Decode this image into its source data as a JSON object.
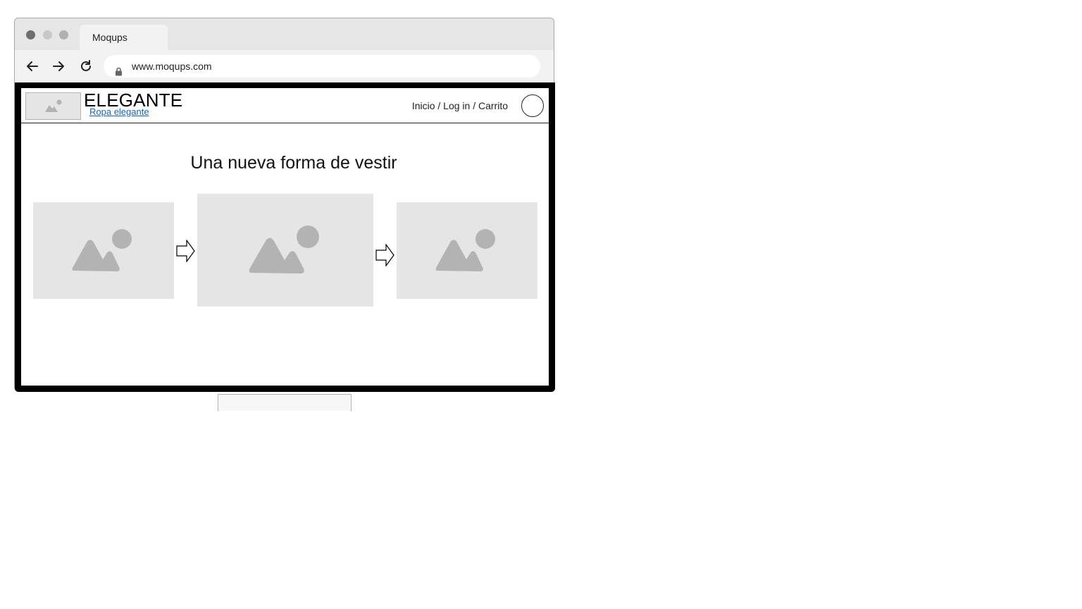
{
  "browser": {
    "tab_title": "Moqups",
    "url": "www.moqups.com",
    "window_dots": [
      "#6e6e6e",
      "#c8c8c8",
      "#b0b0b0"
    ]
  },
  "site": {
    "brand_title": "ELEGANTE",
    "brand_link": "Ropa elegante",
    "nav_links": "Inicio / Log in / Carrito",
    "hero_title": "Una nueva forma de vestir",
    "carousel": [
      {
        "icon": "image-placeholder-icon"
      },
      {
        "icon": "image-placeholder-icon"
      },
      {
        "icon": "image-placeholder-icon"
      }
    ]
  },
  "colors": {
    "frame": "#000000",
    "placeholder_bg": "#e5e5e5",
    "placeholder_icon": "#b3b3b3",
    "link": "#1565c0"
  }
}
